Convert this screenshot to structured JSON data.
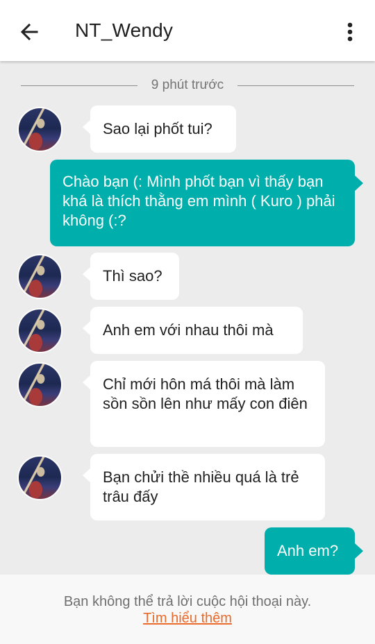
{
  "header": {
    "title": "NT_Wendy",
    "back_icon": "arrow-left-icon",
    "menu_icon": "more-vertical-icon"
  },
  "chat": {
    "time_separator": "9 phút trước",
    "messages": [
      {
        "sender": "other",
        "text": "Sao lại phốt tui?"
      },
      {
        "sender": "me",
        "text": "Chào bạn (: Mình phốt bạn vì thấy bạn khá là thích thằng em mình ( Kuro ) phải không (:?"
      },
      {
        "sender": "other",
        "text": "Thì sao?"
      },
      {
        "sender": "other",
        "text": "Anh em với nhau thôi mà"
      },
      {
        "sender": "other",
        "text": "Chỉ mới hôn má thôi mà làm sồn sồn lên như mấy con điên"
      },
      {
        "sender": "other",
        "text": "Bạn chửi thề nhiều quá là trẻ trâu đấy"
      },
      {
        "sender": "me",
        "text": "Anh em?"
      }
    ]
  },
  "footer": {
    "note": "Bạn không thể trả lời cuộc hội thoại này.",
    "link": "Tìm hiểu thêm"
  },
  "colors": {
    "outgoing_bubble": "#00aeab",
    "incoming_bubble": "#ffffff",
    "background": "#ececec",
    "link": "#ea6a2b"
  }
}
